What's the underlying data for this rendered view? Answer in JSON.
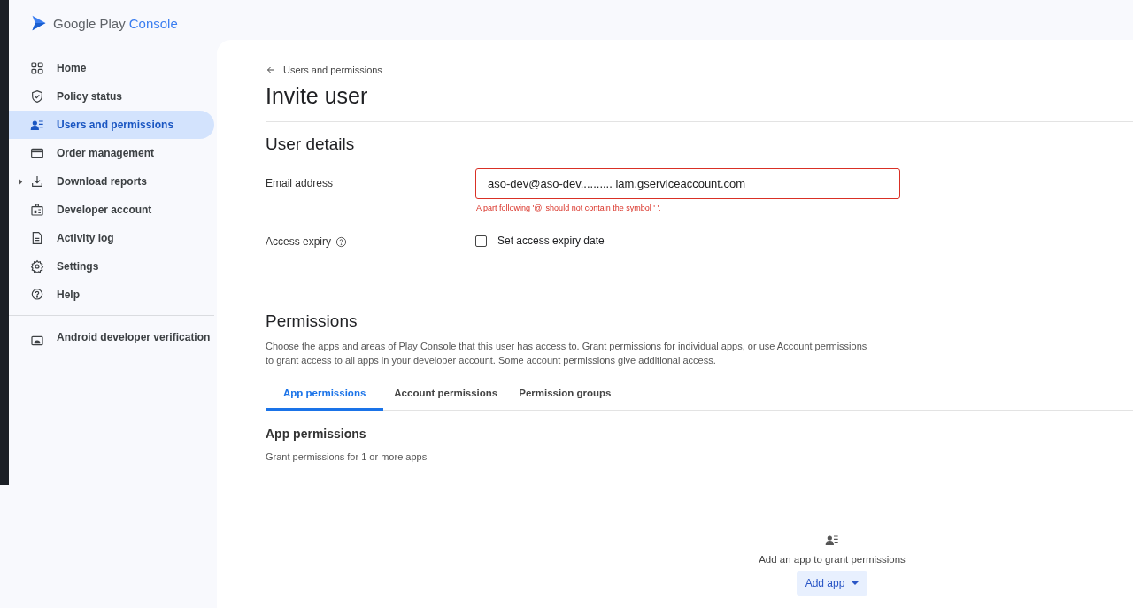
{
  "logo": {
    "brand": "Google Play",
    "product": "Console"
  },
  "sidebar": {
    "items": [
      {
        "label": "Home",
        "selected": false,
        "expandable": false
      },
      {
        "label": "Policy status",
        "selected": false,
        "expandable": false
      },
      {
        "label": "Users and permissions",
        "selected": true,
        "expandable": false
      },
      {
        "label": "Order management",
        "selected": false,
        "expandable": false
      },
      {
        "label": "Download reports",
        "selected": false,
        "expandable": true
      },
      {
        "label": "Developer account",
        "selected": false,
        "expandable": false
      },
      {
        "label": "Activity log",
        "selected": false,
        "expandable": false
      },
      {
        "label": "Settings",
        "selected": false,
        "expandable": false
      },
      {
        "label": "Help",
        "selected": false,
        "expandable": false
      }
    ],
    "footer_items": [
      {
        "label": "Android developer verification",
        "selected": false
      }
    ]
  },
  "breadcrumb": "Users and permissions",
  "title": "Invite user",
  "user_details": {
    "heading": "User details",
    "email": {
      "label": "Email address",
      "value": "aso-dev@aso-dev.......... iam.gserviceaccount.com",
      "error": "A part following '@' should not contain the symbol ' '."
    },
    "access_expiry": {
      "label": "Access expiry",
      "checkbox_label": "Set access expiry date",
      "checked": false
    }
  },
  "permissions": {
    "heading": "Permissions",
    "description": "Choose the apps and areas of Play Console that this user has access to. Grant permissions for individual apps, or use Account permissions to grant access to all apps in your developer account. Some account permissions give additional access.",
    "tabs": [
      {
        "label": "App permissions",
        "selected": true
      },
      {
        "label": "Account permissions",
        "selected": false
      },
      {
        "label": "Permission groups",
        "selected": false
      }
    ],
    "section_heading": "App permissions",
    "section_text": "Grant permissions for 1 or more apps",
    "empty_text": "Add an app to grant permissions",
    "add_button": "Add app"
  }
}
